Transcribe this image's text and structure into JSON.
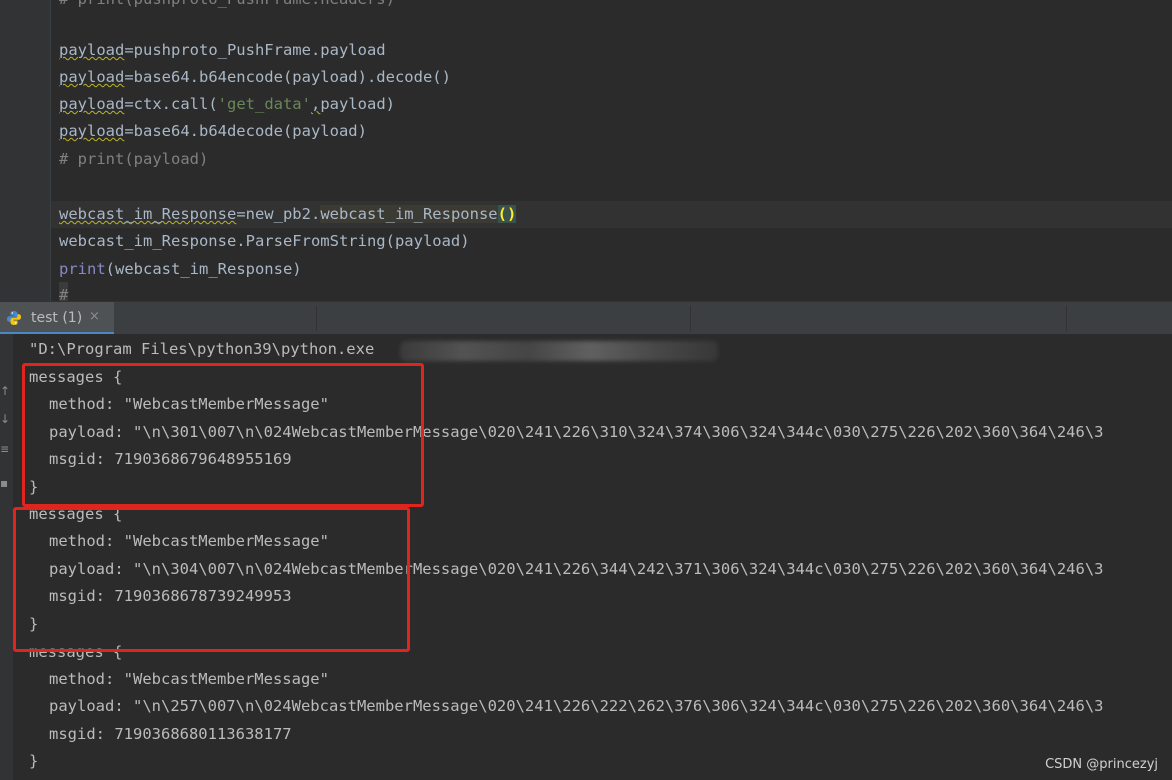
{
  "editor": {
    "lines": {
      "l0": "# print(pushproto_PushFrame.headers)",
      "l1_a": "payload",
      "l1_b": "=pushproto_PushFrame.payload",
      "l2_a": "payload",
      "l2_b": "=base64.b64encode(payload).decode()",
      "l3_a": "payload",
      "l3_b": "=ctx.call(",
      "l3_str": "'get_data'",
      "l3_c": ",",
      "l3_d": "payload)",
      "l4_a": "payload",
      "l4_b": "=base64.b64decode(payload)",
      "l5": "# print(payload)",
      "l7_a": "webcast_im_Response",
      "l7_b": "=new_pb2.",
      "l7_c": "webcast_im_Response",
      "l7_d": "()",
      "l8": "webcast_im_Response.ParseFromString(payload)",
      "l9_kw": "print",
      "l9_b": "(webcast_im_Response)",
      "l10": "#"
    }
  },
  "run_tab": {
    "label": "test (1)",
    "close": "×"
  },
  "console": {
    "cmd": "\"D:\\Program Files\\python39\\python.exe",
    "blocks": [
      {
        "open": "messages {",
        "method": "method: \"WebcastMemberMessage\"",
        "payload": "payload: \"\\n\\301\\007\\n\\024WebcastMemberMessage\\020\\241\\226\\310\\324\\374\\306\\324\\344c\\030\\275\\226\\202\\360\\364\\246\\3",
        "msgid": "msgid: 7190368679648955169",
        "close": "}"
      },
      {
        "open": "messages {",
        "method": "method: \"WebcastMemberMessage\"",
        "payload": "payload: \"\\n\\304\\007\\n\\024WebcastMemberMessage\\020\\241\\226\\344\\242\\371\\306\\324\\344c\\030\\275\\226\\202\\360\\364\\246\\3",
        "msgid": "msgid: 7190368678739249953",
        "close": "}"
      },
      {
        "open": "messages {",
        "method": "method: \"WebcastMemberMessage\"",
        "payload": "payload: \"\\n\\257\\007\\n\\024WebcastMemberMessage\\020\\241\\226\\222\\262\\376\\306\\324\\344c\\030\\275\\226\\202\\360\\364\\246\\3",
        "msgid": "msgid: 7190368680113638177",
        "close": "}"
      }
    ]
  },
  "watermark": "CSDN @princezyj",
  "colors": {
    "highlight_box": "#e0251f",
    "string": "#6a8759",
    "comment": "#808080",
    "builtin": "#8888c6",
    "tab_underline": "#4a88c7"
  },
  "icons": {
    "tab": "python-icon"
  }
}
